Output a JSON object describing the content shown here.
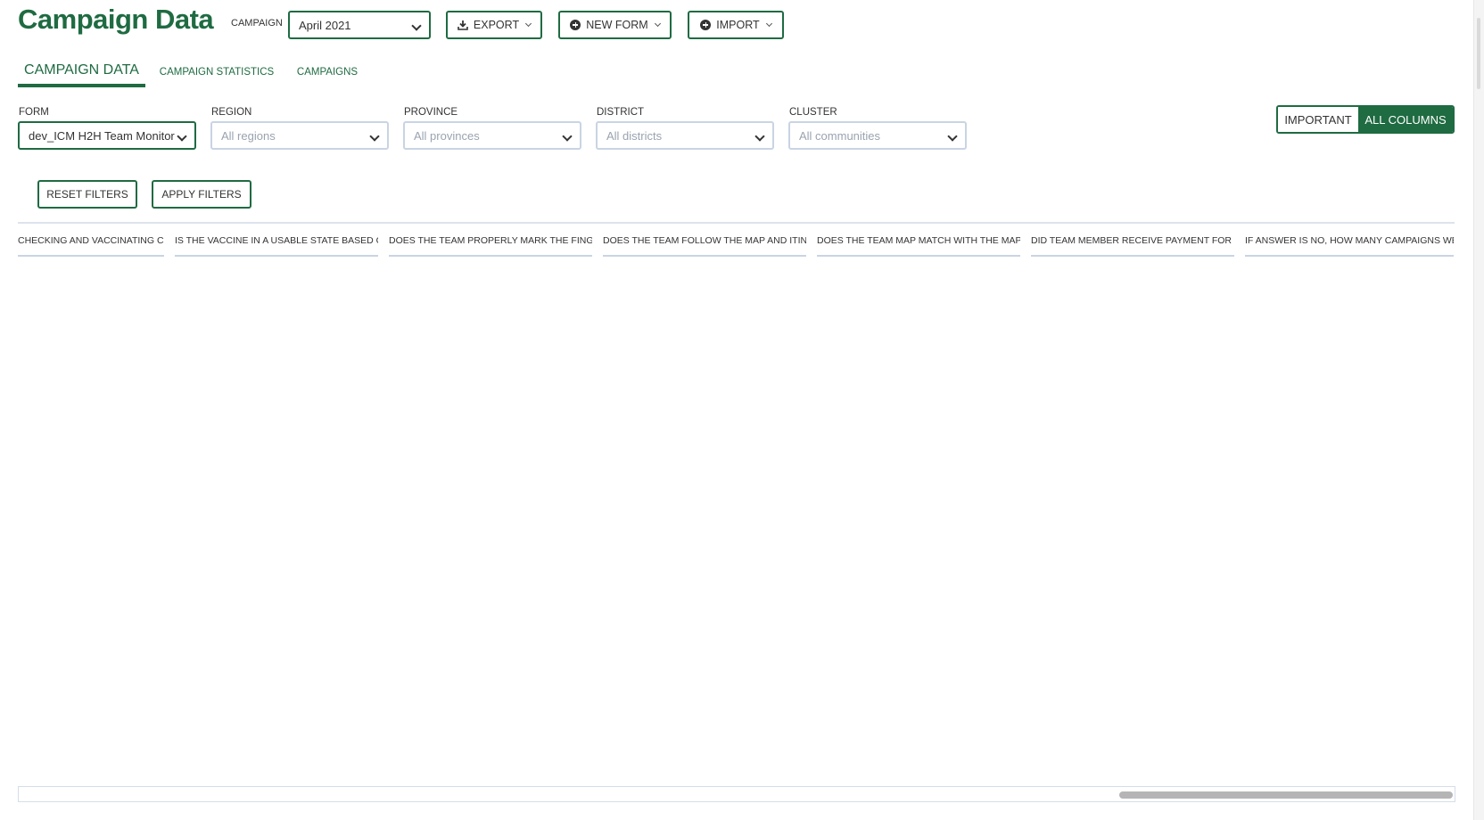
{
  "header": {
    "title": "Campaign Data",
    "campaign_label": "CAMPAIGN",
    "campaign_value": "April 2021",
    "export_label": "EXPORT",
    "new_form_label": "NEW FORM",
    "import_label": "IMPORT"
  },
  "tabs": [
    {
      "label": "CAMPAIGN DATA",
      "active": true
    },
    {
      "label": "CAMPAIGN STATISTICS",
      "active": false
    },
    {
      "label": "CAMPAIGNS",
      "active": false
    }
  ],
  "filters": {
    "form": {
      "label": "FORM",
      "value": "dev_ICM H2H Team Monitor"
    },
    "region": {
      "label": "REGION",
      "placeholder": "All regions"
    },
    "province": {
      "label": "PROVINCE",
      "placeholder": "All provinces"
    },
    "district": {
      "label": "DISTRICT",
      "placeholder": "All districts"
    },
    "cluster": {
      "label": "CLUSTER",
      "placeholder": "All communities"
    }
  },
  "column_toggle": {
    "important_label": "IMPORTANT",
    "all_columns_label": "ALL COLUMNS",
    "selected": "ALL COLUMNS"
  },
  "actions": {
    "reset_label": "RESET FILTERS",
    "apply_label": "APPLY FILTERS"
  },
  "grid": {
    "columns": [
      "CHECKING AND VACCINATING C...",
      "IS THE VACCINE IN A USABLE STATE BASED ON...",
      "DOES THE TEAM PROPERLY MARK THE FINGE...",
      "DOES THE TEAM FOLLOW THE MAP AND ITINE...",
      "DOES THE TEAM MAP MATCH WITH THE MAP ...",
      "DID TEAM MEMBER RECEIVE PAYMENT FOR PR...",
      "IF ANSWER IS NO, HOW MANY CAMPAIGNS WE..."
    ]
  },
  "colors": {
    "brand": "#1f6b42",
    "border_inactive": "#c9d4e4"
  },
  "icons": {
    "export": "download-icon",
    "new_form": "plus-circle-icon",
    "import": "plus-circle-icon",
    "dropdown": "chevron-down-icon"
  }
}
